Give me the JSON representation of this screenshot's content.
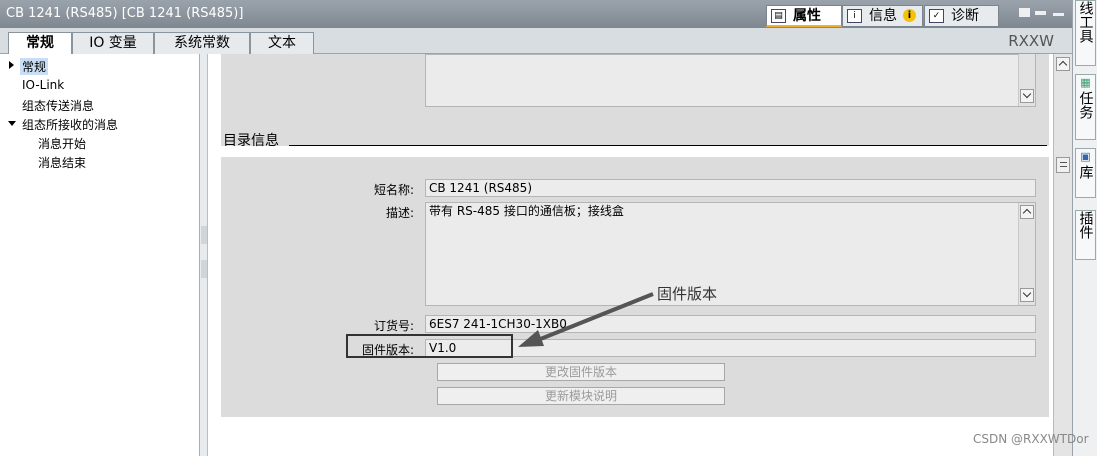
{
  "window": {
    "title": "CB 1241 (RS485) [CB 1241 (RS485)]",
    "panel_tabs": [
      {
        "label": "属性",
        "icon": "properties-icon",
        "active": true
      },
      {
        "label": "信息",
        "icon": "info-list-icon",
        "badge": "i"
      },
      {
        "label": "诊断",
        "icon": "diagnostics-icon"
      }
    ]
  },
  "tabs": [
    "常规",
    "IO 变量",
    "系统常数",
    "文本"
  ],
  "brand_label": "RXXW",
  "tree": {
    "items": [
      {
        "label": "常规",
        "level": 0,
        "expander": "collapsed",
        "selected": true
      },
      {
        "label": "IO-Link",
        "level": 0
      },
      {
        "label": "组态传送消息",
        "level": 0
      },
      {
        "label": "组态所接收的消息",
        "level": 0,
        "expander": "expanded"
      },
      {
        "label": "消息开始",
        "level": 1
      },
      {
        "label": "消息结束",
        "level": 1
      }
    ]
  },
  "catalog": {
    "section_title": "目录信息",
    "short_name_label": "短名称:",
    "short_name": "CB 1241 (RS485)",
    "description_label": "描述:",
    "description": "带有 RS-485 接口的通信板；接线盒",
    "order_no_label": "订货号:",
    "order_no": "6ES7 241-1CH30-1XB0",
    "firmware_label": "固件版本:",
    "firmware": "V1.0",
    "change_fw_button": "更改固件版本",
    "update_desc_button": "更新模块说明"
  },
  "annotation": {
    "text": "固件版本"
  },
  "side_tabs": [
    "线工具",
    "任务",
    "库",
    "插件"
  ],
  "watermark": "CSDN @RXXWTDor"
}
